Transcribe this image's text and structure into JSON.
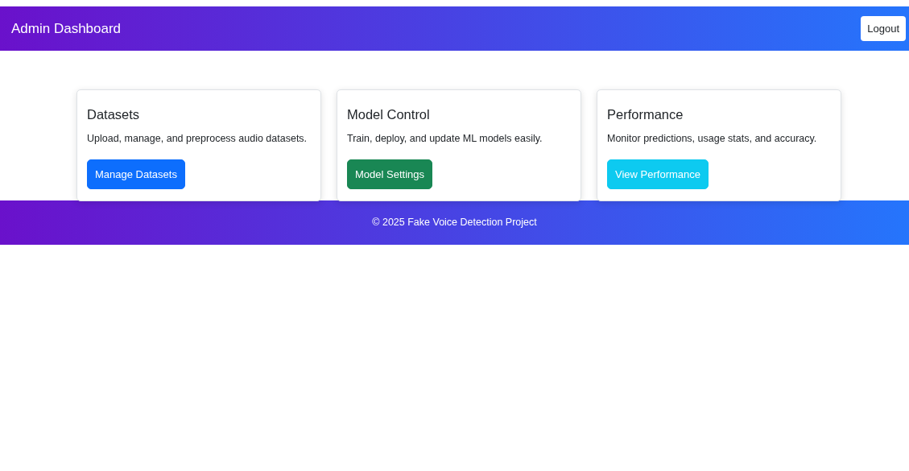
{
  "navbar": {
    "brand": "Admin Dashboard",
    "button": "Logout"
  },
  "cards": [
    {
      "title": "Datasets",
      "text": "Upload, manage, and preprocess audio datasets.",
      "button": "Manage Datasets",
      "color": "#0d6efd"
    },
    {
      "title": "Model Control",
      "text": "Train, deploy, and update ML models easily.",
      "button": "Model Settings",
      "color": "#198754"
    },
    {
      "title": "Performance",
      "text": "Monitor predictions, usage stats, and accuracy.",
      "button": "View Performance",
      "color": "#0dcaf0"
    }
  ],
  "footer": {
    "text": "© 2025 Fake Voice Detection Project"
  }
}
